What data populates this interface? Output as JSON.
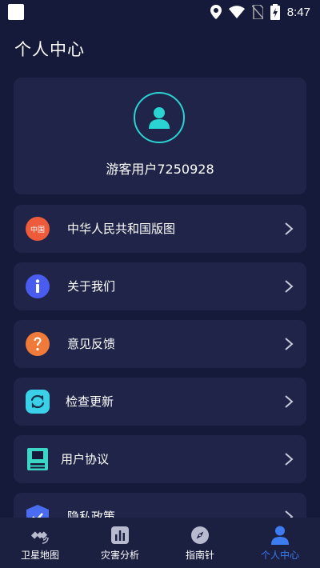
{
  "status_bar": {
    "time": "8:47"
  },
  "header": {
    "title": "个人中心"
  },
  "profile": {
    "username": "游客用户7250928"
  },
  "menu": [
    {
      "label": "中华人民共和国版图",
      "icon": "china-badge-icon",
      "badge_text": "中国"
    },
    {
      "label": "关于我们",
      "icon": "info-icon"
    },
    {
      "label": "意见反馈",
      "icon": "question-icon"
    },
    {
      "label": "检查更新",
      "icon": "refresh-icon"
    },
    {
      "label": "用户协议",
      "icon": "document-icon"
    },
    {
      "label": "隐私政策",
      "icon": "shield-icon"
    }
  ],
  "bottom_nav": [
    {
      "label": "卫星地图",
      "icon": "satellite-icon",
      "active": false
    },
    {
      "label": "灾害分析",
      "icon": "chart-icon",
      "active": false
    },
    {
      "label": "指南针",
      "icon": "compass-icon",
      "active": false
    },
    {
      "label": "个人中心",
      "icon": "person-icon",
      "active": true
    }
  ],
  "colors": {
    "background": "#161a3a",
    "card": "#1f2448",
    "accent_cyan": "#29d4d2",
    "active_tab": "#3d7bf0",
    "badge_red": "#ee5b3b",
    "info_blue": "#4a5cf0",
    "question_orange": "#f07a3a",
    "refresh_cyan": "#3ad0e8",
    "document_cyan": "#3ad6c6"
  }
}
